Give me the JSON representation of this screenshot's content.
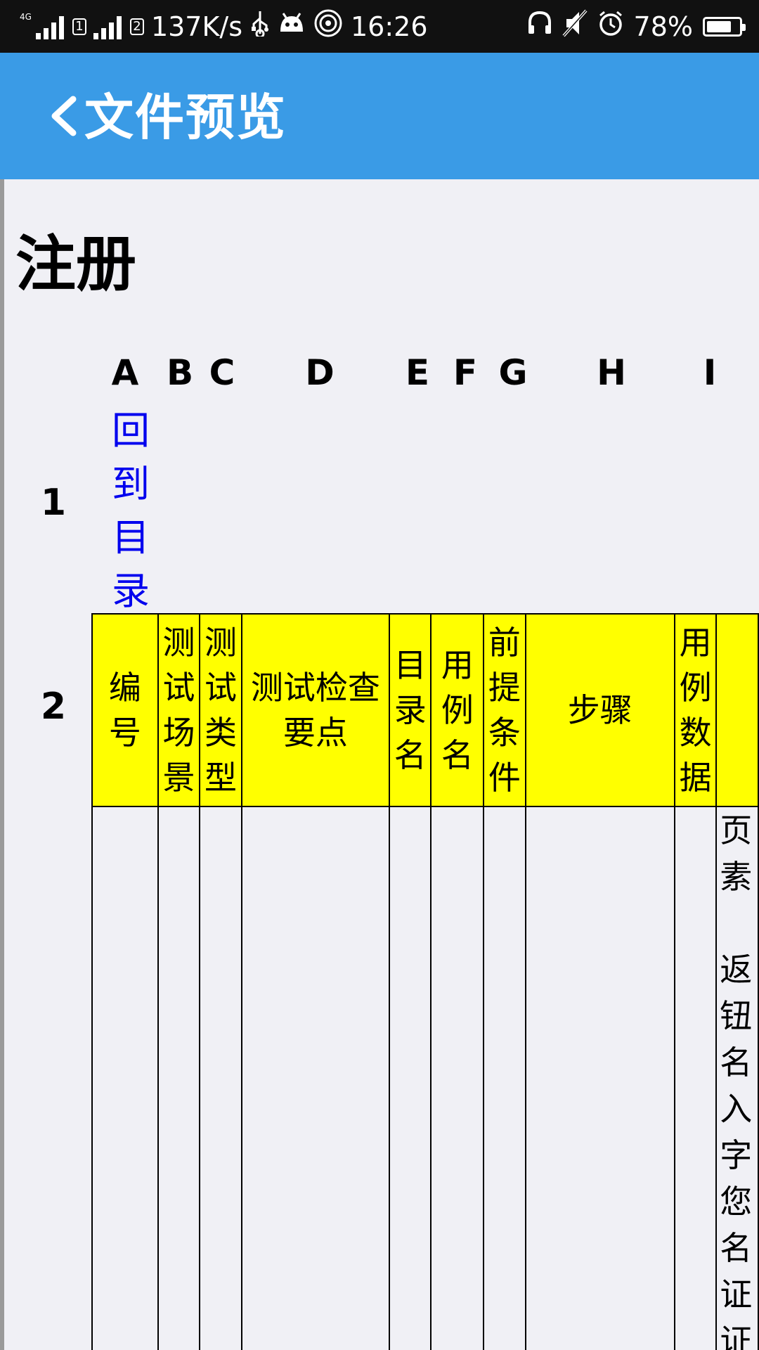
{
  "status_bar": {
    "network_type": "4G",
    "sim1": "1",
    "sim2": "2",
    "speed": "137K/s",
    "time": "16:26",
    "battery": "78%",
    "battery_level": 0.78,
    "icons": [
      "signal-icon",
      "usb-icon",
      "android-icon",
      "hotspot-icon",
      "headphone-icon",
      "mute-icon",
      "alarm-icon",
      "battery-icon"
    ]
  },
  "app_bar": {
    "title": "文件预览",
    "back_icon": "chevron-left-icon",
    "color": "#3a9be6"
  },
  "sheet": {
    "title": "注册",
    "columns": [
      "A",
      "B",
      "C",
      "D",
      "E",
      "F",
      "G",
      "H",
      "I"
    ],
    "rows": [
      "1",
      "2"
    ],
    "link": {
      "text": "回到目录",
      "color": "#0000ee"
    },
    "header_color": "#ffff00",
    "headers": [
      "编号",
      "测试场景",
      "测试类型",
      "测试检查要点",
      "目录名",
      "用例名",
      "前提条件",
      "步骤",
      "用例数据",
      ""
    ],
    "partial_cell": "页\n素\n\n返\n钮\n名\n入\n字\n您\n名\n证\n证"
  }
}
